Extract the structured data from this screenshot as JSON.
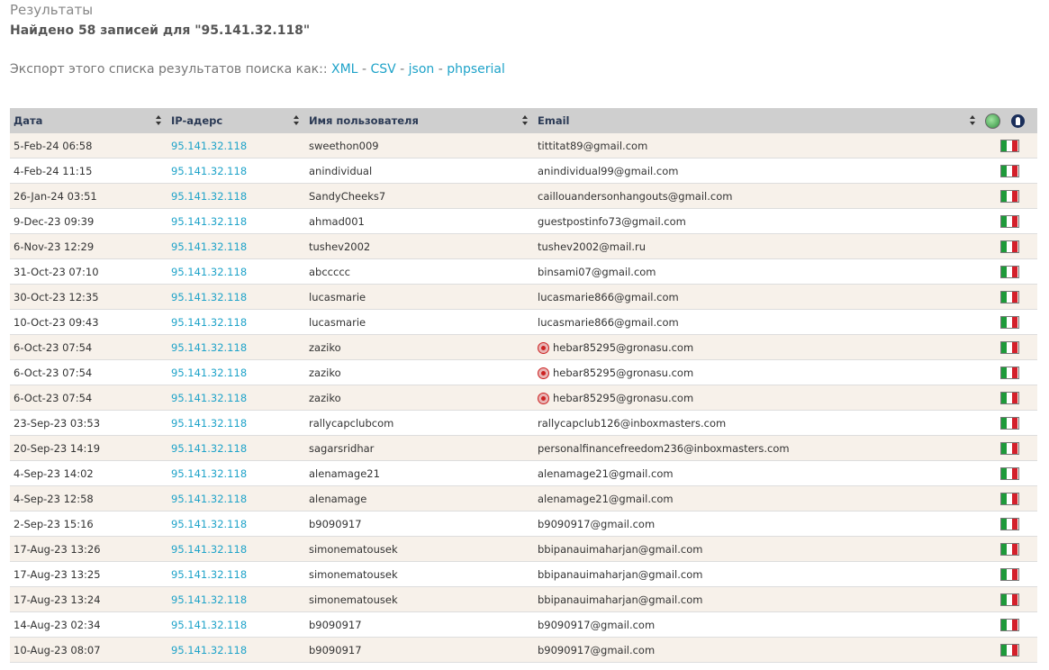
{
  "heading": "Результаты",
  "found": "Найдено 58 записей для \"95.141.32.118\"",
  "export": {
    "prefix": "Экспорт этого списка результатов поиска как::",
    "links": [
      "XML",
      "CSV",
      "json",
      "phpserial"
    ],
    "sep": " - "
  },
  "columns": [
    "Дата",
    "IP-адерс",
    "Имя пользователя",
    "Email"
  ],
  "header_icons": [
    "globe-icon",
    "user-icon"
  ],
  "flag": "italy-flag",
  "rows": [
    {
      "date": "5-Feb-24 06:58",
      "ip": "95.141.32.118",
      "user": "sweethon009",
      "email": "tittitat89@gmail.com",
      "danger": false
    },
    {
      "date": "4-Feb-24 11:15",
      "ip": "95.141.32.118",
      "user": "anindividual",
      "email": "anindividual99@gmail.com",
      "danger": false
    },
    {
      "date": "26-Jan-24 03:51",
      "ip": "95.141.32.118",
      "user": "SandyCheeks7",
      "email": "caillouandersonhangouts@gmail.com",
      "danger": false
    },
    {
      "date": "9-Dec-23 09:39",
      "ip": "95.141.32.118",
      "user": "ahmad001",
      "email": "guestpostinfo73@gmail.com",
      "danger": false
    },
    {
      "date": "6-Nov-23 12:29",
      "ip": "95.141.32.118",
      "user": "tushev2002",
      "email": "tushev2002@mail.ru",
      "danger": false
    },
    {
      "date": "31-Oct-23 07:10",
      "ip": "95.141.32.118",
      "user": "abccccc",
      "email": "binsami07@gmail.com",
      "danger": false
    },
    {
      "date": "30-Oct-23 12:35",
      "ip": "95.141.32.118",
      "user": "lucasmarie",
      "email": "lucasmarie866@gmail.com",
      "danger": false
    },
    {
      "date": "10-Oct-23 09:43",
      "ip": "95.141.32.118",
      "user": "lucasmarie",
      "email": "lucasmarie866@gmail.com",
      "danger": false
    },
    {
      "date": "6-Oct-23 07:54",
      "ip": "95.141.32.118",
      "user": "zaziko",
      "email": "hebar85295@gronasu.com",
      "danger": true
    },
    {
      "date": "6-Oct-23 07:54",
      "ip": "95.141.32.118",
      "user": "zaziko",
      "email": "hebar85295@gronasu.com",
      "danger": true
    },
    {
      "date": "6-Oct-23 07:54",
      "ip": "95.141.32.118",
      "user": "zaziko",
      "email": "hebar85295@gronasu.com",
      "danger": true
    },
    {
      "date": "23-Sep-23 03:53",
      "ip": "95.141.32.118",
      "user": "rallycapclubcom",
      "email": "rallycapclub126@inboxmasters.com",
      "danger": false
    },
    {
      "date": "20-Sep-23 14:19",
      "ip": "95.141.32.118",
      "user": "sagarsridhar",
      "email": "personalfinancefreedom236@inboxmasters.com",
      "danger": false
    },
    {
      "date": "4-Sep-23 14:02",
      "ip": "95.141.32.118",
      "user": "alenamage21",
      "email": "alenamage21@gmail.com",
      "danger": false
    },
    {
      "date": "4-Sep-23 12:58",
      "ip": "95.141.32.118",
      "user": "alenamage",
      "email": "alenamage21@gmail.com",
      "danger": false
    },
    {
      "date": "2-Sep-23 15:16",
      "ip": "95.141.32.118",
      "user": "b9090917",
      "email": "b9090917@gmail.com",
      "danger": false
    },
    {
      "date": "17-Aug-23 13:26",
      "ip": "95.141.32.118",
      "user": "simonematousek",
      "email": "bbipanauimaharjan@gmail.com",
      "danger": false
    },
    {
      "date": "17-Aug-23 13:25",
      "ip": "95.141.32.118",
      "user": "simonematousek",
      "email": "bbipanauimaharjan@gmail.com",
      "danger": false
    },
    {
      "date": "17-Aug-23 13:24",
      "ip": "95.141.32.118",
      "user": "simonematousek",
      "email": "bbipanauimaharjan@gmail.com",
      "danger": false
    },
    {
      "date": "14-Aug-23 02:34",
      "ip": "95.141.32.118",
      "user": "b9090917",
      "email": "b9090917@gmail.com",
      "danger": false
    },
    {
      "date": "10-Aug-23 08:07",
      "ip": "95.141.32.118",
      "user": "b9090917",
      "email": "b9090917@gmail.com",
      "danger": false
    }
  ]
}
